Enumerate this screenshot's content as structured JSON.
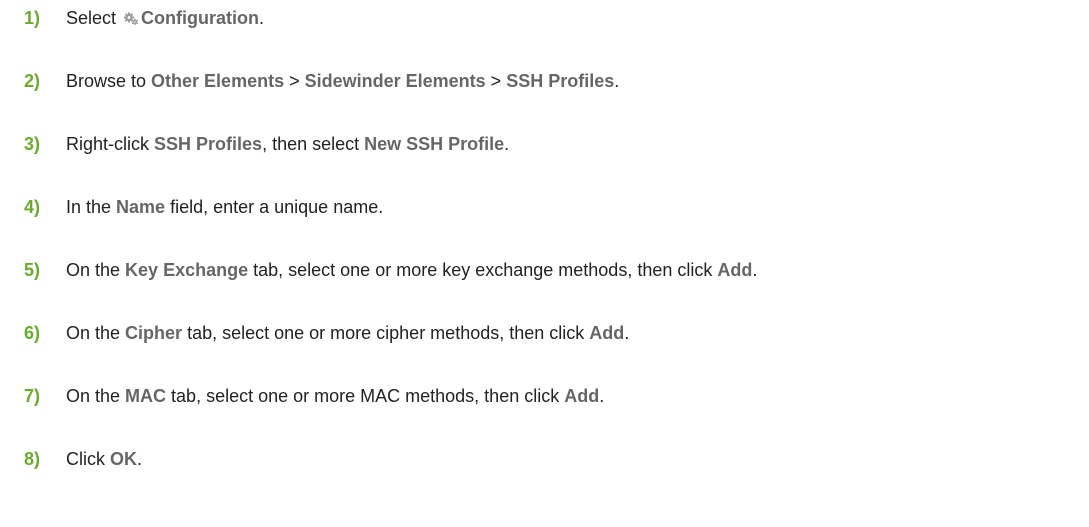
{
  "colors": {
    "step_number": "#6aaa2e",
    "ui_term": "#666666",
    "body_text": "#222222"
  },
  "steps": [
    {
      "number": "1)",
      "parts": [
        {
          "text": "Select "
        },
        {
          "icon": "gear-icon"
        },
        {
          "text": "Configuration",
          "ui": true
        },
        {
          "text": "."
        }
      ]
    },
    {
      "number": "2)",
      "parts": [
        {
          "text": "Browse to "
        },
        {
          "text": "Other Elements",
          "ui": true
        },
        {
          "text": " > "
        },
        {
          "text": "Sidewinder Elements",
          "ui": true
        },
        {
          "text": " > "
        },
        {
          "text": "SSH Profiles",
          "ui": true
        },
        {
          "text": "."
        }
      ]
    },
    {
      "number": "3)",
      "parts": [
        {
          "text": "Right-click "
        },
        {
          "text": "SSH Profiles",
          "ui": true
        },
        {
          "text": ", then select "
        },
        {
          "text": "New SSH Profile",
          "ui": true
        },
        {
          "text": "."
        }
      ]
    },
    {
      "number": "4)",
      "parts": [
        {
          "text": "In the "
        },
        {
          "text": "Name",
          "ui": true
        },
        {
          "text": " field, enter a unique name."
        }
      ]
    },
    {
      "number": "5)",
      "parts": [
        {
          "text": "On the "
        },
        {
          "text": "Key Exchange",
          "ui": true
        },
        {
          "text": " tab, select one or more key exchange methods, then click "
        },
        {
          "text": "Add",
          "ui": true
        },
        {
          "text": "."
        }
      ]
    },
    {
      "number": "6)",
      "parts": [
        {
          "text": "On the "
        },
        {
          "text": "Cipher",
          "ui": true
        },
        {
          "text": " tab, select one or more cipher methods, then click "
        },
        {
          "text": "Add",
          "ui": true
        },
        {
          "text": "."
        }
      ]
    },
    {
      "number": "7)",
      "parts": [
        {
          "text": "On the "
        },
        {
          "text": "MAC",
          "ui": true
        },
        {
          "text": " tab, select one or more MAC methods, then click "
        },
        {
          "text": "Add",
          "ui": true
        },
        {
          "text": "."
        }
      ]
    },
    {
      "number": "8)",
      "parts": [
        {
          "text": "Click "
        },
        {
          "text": "OK",
          "ui": true
        },
        {
          "text": "."
        }
      ]
    }
  ]
}
